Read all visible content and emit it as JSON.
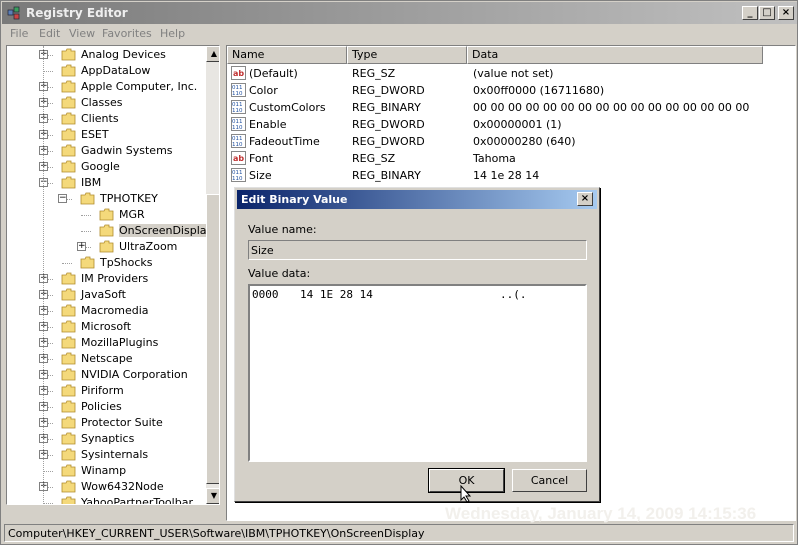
{
  "window": {
    "title": "Registry Editor"
  },
  "menu": [
    "File",
    "Edit",
    "View",
    "Favorites",
    "Help"
  ],
  "tree": {
    "items": [
      {
        "label": "Analog Devices",
        "level": 1,
        "expandable": true
      },
      {
        "label": "AppDataLow",
        "level": 1,
        "expandable": false
      },
      {
        "label": "Apple Computer, Inc.",
        "level": 1,
        "expandable": true
      },
      {
        "label": "Classes",
        "level": 1,
        "expandable": true
      },
      {
        "label": "Clients",
        "level": 1,
        "expandable": true
      },
      {
        "label": "ESET",
        "level": 1,
        "expandable": true
      },
      {
        "label": "Gadwin Systems",
        "level": 1,
        "expandable": true
      },
      {
        "label": "Google",
        "level": 1,
        "expandable": true
      },
      {
        "label": "IBM",
        "level": 1,
        "expandable": true,
        "expanded": true
      },
      {
        "label": "TPHOTKEY",
        "level": 2,
        "expandable": true,
        "expanded": true
      },
      {
        "label": "MGR",
        "level": 3,
        "expandable": false
      },
      {
        "label": "OnScreenDisplay",
        "level": 3,
        "expandable": false,
        "selected": true
      },
      {
        "label": "UltraZoom",
        "level": 3,
        "expandable": true
      },
      {
        "label": "TpShocks",
        "level": 2,
        "expandable": false
      },
      {
        "label": "IM Providers",
        "level": 1,
        "expandable": true
      },
      {
        "label": "JavaSoft",
        "level": 1,
        "expandable": true
      },
      {
        "label": "Macromedia",
        "level": 1,
        "expandable": true
      },
      {
        "label": "Microsoft",
        "level": 1,
        "expandable": true
      },
      {
        "label": "MozillaPlugins",
        "level": 1,
        "expandable": true
      },
      {
        "label": "Netscape",
        "level": 1,
        "expandable": true
      },
      {
        "label": "NVIDIA Corporation",
        "level": 1,
        "expandable": true
      },
      {
        "label": "Piriform",
        "level": 1,
        "expandable": true
      },
      {
        "label": "Policies",
        "level": 1,
        "expandable": true
      },
      {
        "label": "Protector Suite",
        "level": 1,
        "expandable": true
      },
      {
        "label": "Synaptics",
        "level": 1,
        "expandable": true
      },
      {
        "label": "Sysinternals",
        "level": 1,
        "expandable": true
      },
      {
        "label": "Winamp",
        "level": 1,
        "expandable": false
      },
      {
        "label": "Wow6432Node",
        "level": 1,
        "expandable": true
      },
      {
        "label": "YahooPartnerToolbar",
        "level": 1,
        "expandable": false
      }
    ]
  },
  "list": {
    "columns": [
      "Name",
      "Type",
      "Data"
    ],
    "rows": [
      {
        "icon": "string-value-icon",
        "name": "(Default)",
        "type": "REG_SZ",
        "data": "(value not set)"
      },
      {
        "icon": "binary-value-icon",
        "name": "Color",
        "type": "REG_DWORD",
        "data": "0x00ff0000 (16711680)"
      },
      {
        "icon": "binary-value-icon",
        "name": "CustomColors",
        "type": "REG_BINARY",
        "data": "00 00 00 00 00 00 00 00 00 00 00 00 00 00 00 00"
      },
      {
        "icon": "binary-value-icon",
        "name": "Enable",
        "type": "REG_DWORD",
        "data": "0x00000001 (1)"
      },
      {
        "icon": "binary-value-icon",
        "name": "FadeoutTime",
        "type": "REG_DWORD",
        "data": "0x00000280 (640)"
      },
      {
        "icon": "string-value-icon",
        "name": "Font",
        "type": "REG_SZ",
        "data": "Tahoma"
      },
      {
        "icon": "binary-value-icon",
        "name": "Size",
        "type": "REG_BINARY",
        "data": "14 1e 28 14"
      }
    ]
  },
  "dialog": {
    "title": "Edit Binary Value",
    "value_name_label": "Value name:",
    "value_name": "Size",
    "value_data_label": "Value data:",
    "offset": "0000",
    "hex": "14 1E 28 14",
    "ascii": "..(.",
    "ok_label": "OK",
    "cancel_label": "Cancel"
  },
  "statusbar": {
    "path": "Computer\\HKEY_CURRENT_USER\\Software\\IBM\\TPHOTKEY\\OnScreenDisplay"
  },
  "clock": "Wednesday, January 14, 2009 14:15:36",
  "colors": {
    "dialog_title_start": "#0a246a",
    "dialog_title_end": "#a6caf0",
    "window_face": "#d4d0c8"
  }
}
